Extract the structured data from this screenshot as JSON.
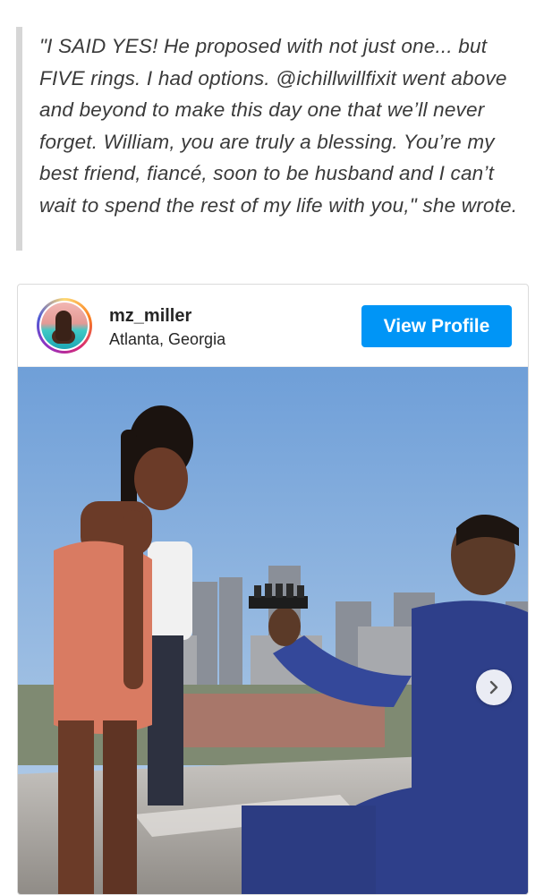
{
  "article": {
    "quote": "\"I SAID YES! He proposed with not just one... but FIVE rings. I had options. @ichillwillfixit went above and beyond to make this day one that we’ll never forget. William, you are truly a blessing. You’re my best friend, fiancé, soon to be husband and I can’t wait to spend the rest of my life with you,\" she wrote."
  },
  "instagram_embed": {
    "username": "mz_miller",
    "location": "Atlanta, Georgia",
    "view_profile_label": "View Profile",
    "avatar_icon": "profile-avatar",
    "next_icon": "chevron-right-icon",
    "brand_color": "#0095f6"
  }
}
